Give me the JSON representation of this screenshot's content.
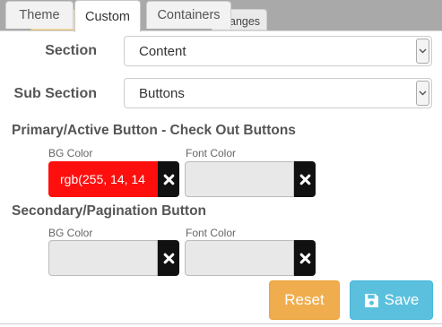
{
  "tabs": [
    {
      "label": "Theme",
      "active": false
    },
    {
      "label": "Custom",
      "active": true
    },
    {
      "label": "Containers",
      "active": false
    }
  ],
  "behind_tabs": {
    "second_label": "anges"
  },
  "form": {
    "section": {
      "label": "Section",
      "value": "Content"
    },
    "sub_section": {
      "label": "Sub Section",
      "value": "Buttons"
    }
  },
  "primary": {
    "heading": "Primary/Active Button - Check Out Buttons",
    "bg_label": "BG Color",
    "bg_value": "rgb(255, 14, 14",
    "bg_color": "#ff0e0e",
    "font_label": "Font Color",
    "font_value": ""
  },
  "secondary": {
    "heading": "Secondary/Pagination Button",
    "bg_label": "BG Color",
    "bg_value": "",
    "font_label": "Font Color",
    "font_value": ""
  },
  "actions": {
    "reset_label": "Reset",
    "save_label": "Save",
    "reset_color": "#f0ad4e",
    "save_color": "#5bc0de"
  }
}
